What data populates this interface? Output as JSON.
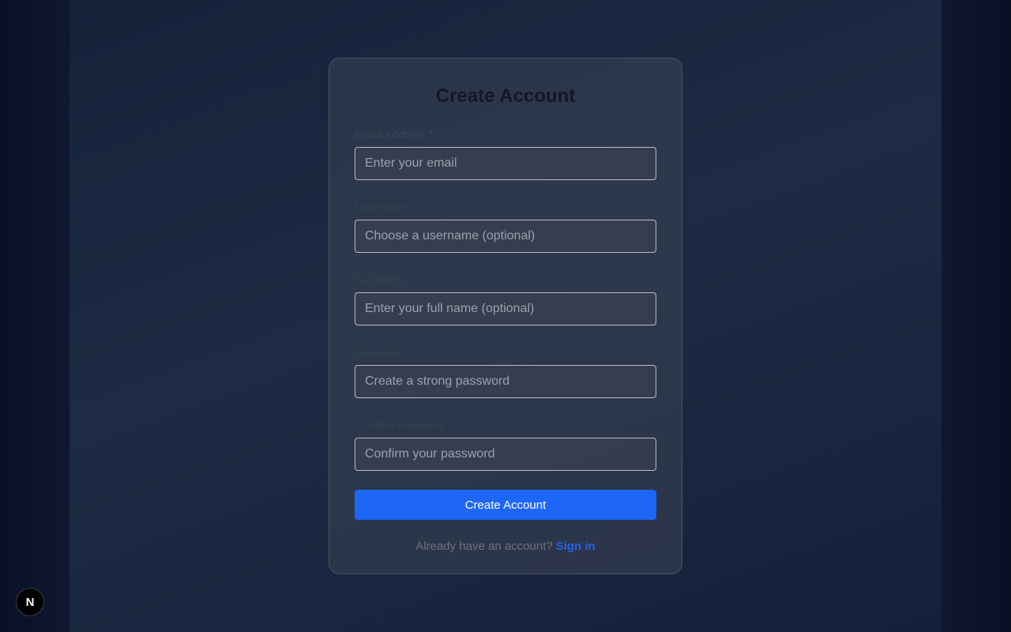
{
  "form": {
    "title": "Create Account",
    "fields": [
      {
        "label": "Email Address *",
        "placeholder": "Enter your email",
        "value": ""
      },
      {
        "label": "Username",
        "placeholder": "Choose a username (optional)",
        "value": ""
      },
      {
        "label": "Full Name",
        "placeholder": "Enter your full name (optional)",
        "value": ""
      },
      {
        "label": "Password *",
        "placeholder": "Create a strong password",
        "value": ""
      },
      {
        "label": "Confirm Password *",
        "placeholder": "Confirm your password",
        "value": ""
      }
    ],
    "submit_label": "Create Account",
    "footer_text": "Already have an account?",
    "footer_link": "Sign in"
  },
  "badge": {
    "letter": "N",
    "icon": "nextjs-logo-icon"
  },
  "colors": {
    "accent": "#1e66f5",
    "link": "#2563eb"
  }
}
